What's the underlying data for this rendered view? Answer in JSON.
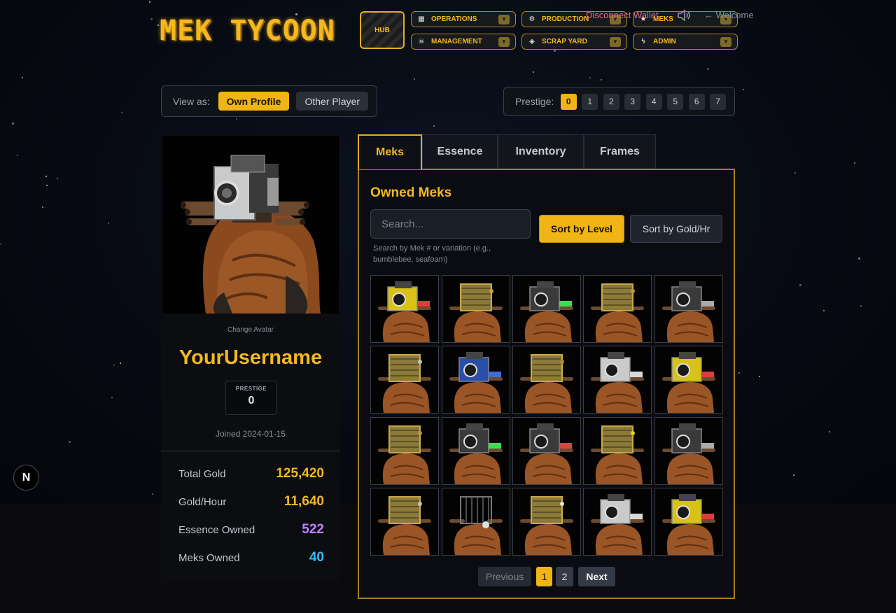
{
  "app": {
    "logo_text": "MEK TYCOON",
    "hub_label": "HUB"
  },
  "nav": {
    "items": [
      {
        "label": "OPERATIONS",
        "icon": "chart-bar-icon"
      },
      {
        "label": "PRODUCTION",
        "icon": "gear-icon"
      },
      {
        "label": "MEKS",
        "icon": "star-icon"
      },
      {
        "label": "MANAGEMENT",
        "icon": "skull-icon"
      },
      {
        "label": "SCRAP YARD",
        "icon": "gamepad-icon"
      },
      {
        "label": "ADMIN",
        "icon": "lightning-icon"
      }
    ],
    "caret": "▼"
  },
  "header": {
    "disconnect_label": "Disconnect Wallet",
    "welcome_label": "← Welcome"
  },
  "view_as": {
    "label": "View as:",
    "own_profile": "Own Profile",
    "other_player": "Other Player",
    "selected": "Own Profile"
  },
  "prestige_selector": {
    "label": "Prestige:",
    "levels": [
      "0",
      "1",
      "2",
      "3",
      "4",
      "5",
      "6",
      "7"
    ],
    "selected": "0"
  },
  "profile": {
    "change_avatar": "Change Avatar",
    "username": "YourUsername",
    "prestige_label": "PRESTIGE",
    "prestige_value": "0",
    "joined": "Joined 2024-01-15",
    "stats": [
      {
        "label": "Total Gold",
        "value": "125,420",
        "color": "#f4b921"
      },
      {
        "label": "Gold/Hour",
        "value": "11,640",
        "color": "#f4b921"
      },
      {
        "label": "Essence Owned",
        "value": "522",
        "color": "#c084fc"
      },
      {
        "label": "Meks Owned",
        "value": "40",
        "color": "#38bdf8"
      }
    ]
  },
  "tabs": [
    {
      "label": "Meks",
      "active": true
    },
    {
      "label": "Essence",
      "active": false
    },
    {
      "label": "Inventory",
      "active": false
    },
    {
      "label": "Frames",
      "active": false
    }
  ],
  "meks_panel": {
    "title": "Owned Meks",
    "search_placeholder": "Search...",
    "search_hint": "Search by Mek # or variation (e.g., bumblebee, seafoam)",
    "sort_by_level": "Sort by Level",
    "sort_by_gold": "Sort by Gold/Hr",
    "active_sort": "Sort by Level",
    "meks": [
      {
        "head": "camera-yellow",
        "accent": "#e23b3b"
      },
      {
        "head": "gold-box",
        "accent": "#c9a23a"
      },
      {
        "head": "camera-dark",
        "accent": "#3fdc52"
      },
      {
        "head": "gold-box",
        "accent": "#b8963c"
      },
      {
        "head": "camera-dark",
        "accent": "#aaaaaa"
      },
      {
        "head": "gold-box",
        "accent": "#c0c0c0"
      },
      {
        "head": "camera-blue",
        "accent": "#3b6fd8"
      },
      {
        "head": "gold-box",
        "accent": "#a88a45"
      },
      {
        "head": "camera-silver",
        "accent": "#d8d8d8"
      },
      {
        "head": "camera-yellow",
        "accent": "#e23b3b"
      },
      {
        "head": "gold-box",
        "accent": "#b8963c"
      },
      {
        "head": "camera-dark",
        "accent": "#3fdc52"
      },
      {
        "head": "camera-dark",
        "accent": "#e04040"
      },
      {
        "head": "gold-box",
        "accent": "#d8d020"
      },
      {
        "head": "camera-dark",
        "accent": "#aaaaaa"
      },
      {
        "head": "gold-box",
        "accent": "#c0c0c0"
      },
      {
        "head": "cage",
        "accent": "#e0e0e0"
      },
      {
        "head": "gold-box",
        "accent": "#e0e0e0"
      },
      {
        "head": "camera-silver",
        "accent": "#d8d8d8"
      },
      {
        "head": "camera-yellow",
        "accent": "#e23b3b"
      }
    ]
  },
  "pagination": {
    "previous": "Previous",
    "pages": [
      "1",
      "2"
    ],
    "current": "1",
    "next": "Next"
  },
  "dev_badge": "N"
}
